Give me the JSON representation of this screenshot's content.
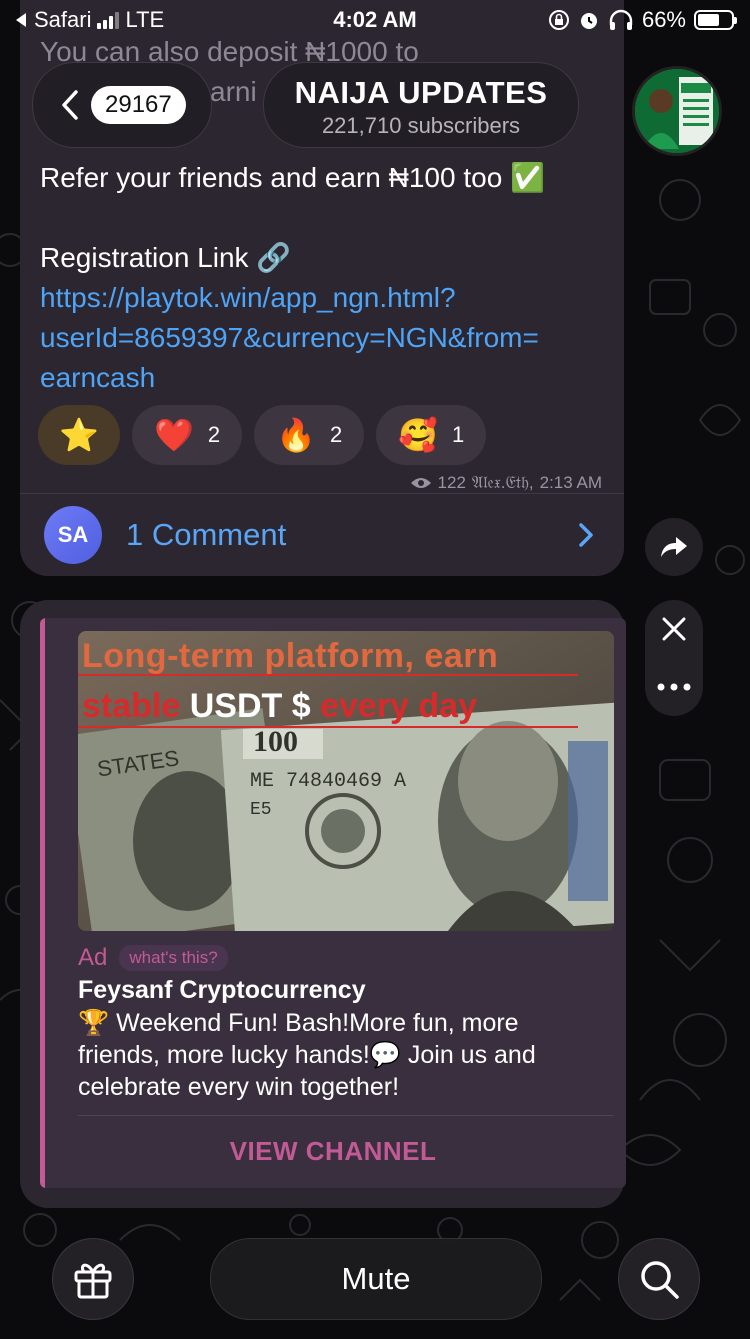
{
  "status_bar": {
    "back_app": "Safari",
    "network": "LTE",
    "time": "4:02 AM",
    "battery": "66%",
    "battery_level": 0.66
  },
  "header": {
    "back_count": "29167",
    "channel_name": "NAIJA UPDATES",
    "subscribers": "221,710 subscribers"
  },
  "message": {
    "partial_line": "You can also deposit ₦1000 to",
    "partial_line2": "arni",
    "refer_line": "Refer your friends and earn ₦100 too",
    "refer_emoji": "✅",
    "registration_label": "Registration Link",
    "registration_emoji": "🔗",
    "link_line1": "https://playtok.win/app_ngn.html?",
    "link_line2": "userId=8659397&currency=NGN&from=",
    "link_line3": "earncash",
    "reactions": [
      {
        "emoji": "⭐",
        "count": ""
      },
      {
        "emoji": "❤️",
        "count": "2"
      },
      {
        "emoji": "🔥",
        "count": "2"
      },
      {
        "emoji": "🥰",
        "count": "1"
      }
    ],
    "views": "122",
    "author": "𝔄𝔩𝔢𝔵.𝔈𝔱𝔥,",
    "time": "2:13 AM",
    "comment_avatar": "SA",
    "comment_label": "1 Comment"
  },
  "ad": {
    "image_line1": "Long-term platform, earn",
    "image_line2_a": "stable ",
    "image_line2_b": "USDT $",
    "image_line2_c": "  every day",
    "banknote_serial": "ME 74840469 A",
    "banknote_code": "E5",
    "banknote_denomination": "100",
    "tag": "Ad",
    "whats_this": "what's this?",
    "title": "Feysanf Cryptocurrency",
    "body": "🏆 Weekend Fun! Bash!More fun, more friends, more lucky hands!💬 Join us and celebrate every win together!",
    "cta": "VIEW CHANNEL"
  },
  "bottom_bar": {
    "mute_label": "Mute"
  },
  "icons": {
    "gift": "gift-icon",
    "search": "search-icon",
    "share": "share-icon",
    "close": "close-icon",
    "more": "more-icon"
  }
}
